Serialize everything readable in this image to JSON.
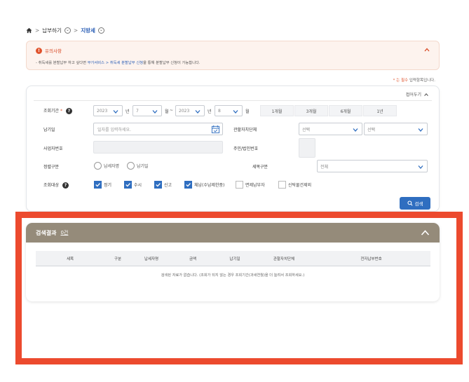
{
  "breadcrumb": {
    "level1": "납부하기",
    "level2": "지방세"
  },
  "notice": {
    "title": "유의사항",
    "text_pre": "- 취득세를 분할납부 하고 싶다면 ",
    "link": "부가서비스 > 취득세 분할납부 신청",
    "text_post": "을 통해 분할납부 신청이 가능합니다."
  },
  "required_note": {
    "mark": "* 는 필수",
    "text": " 입력항목입니다."
  },
  "search": {
    "fold_label": "접어두기",
    "period_label": "조회기간",
    "period_req": "*",
    "from_year": "2023",
    "from_year_unit": "년",
    "from_month": "7",
    "from_month_unit": "월",
    "tilde": "~",
    "to_year": "2023",
    "to_year_unit": "년",
    "to_month": "8",
    "to_month_unit": "월",
    "period_buttons": [
      "1개월",
      "3개월",
      "6개월",
      "1년"
    ],
    "due_label": "납기일",
    "due_placeholder": "일자를 입력하세요.",
    "jurisdiction_label": "관할자치단체",
    "jurisdiction_select1": "선택",
    "jurisdiction_select2": "선택",
    "bizno_label": "사업자번호",
    "resno_label": "주민/법인번호",
    "bill_type_label": "정렬구분",
    "bill_type_options": [
      "납세자명",
      "납기일"
    ],
    "tax_type_label": "세목구분",
    "tax_type_value": "전체",
    "target_label": "조회대상",
    "targets": [
      {
        "label": "정기",
        "checked": true
      },
      {
        "label": "수시",
        "checked": true
      },
      {
        "label": "신고",
        "checked": true
      },
      {
        "label": "체납(수납제한중)",
        "checked": true
      },
      {
        "label": "면제납부자",
        "checked": false
      },
      {
        "label": "신탁물건제외",
        "checked": false
      }
    ],
    "search_button": "검색"
  },
  "results": {
    "title": "검색결과",
    "count": "0건",
    "columns": [
      "세목",
      "구분",
      "납세자명",
      "금액",
      "납기일",
      "관할자치단체",
      "전자납부번호"
    ],
    "empty_message": "검색된 자료가 없습니다. (조회가 되지 않는 경우 조회기간(과세연월)을 더 늘려서 조회하세요.)"
  },
  "colors": {
    "accent": "#2f6ec0",
    "results_header": "#958b7a",
    "highlight_frame": "#ec4a2e",
    "warning": "#e0542e"
  }
}
